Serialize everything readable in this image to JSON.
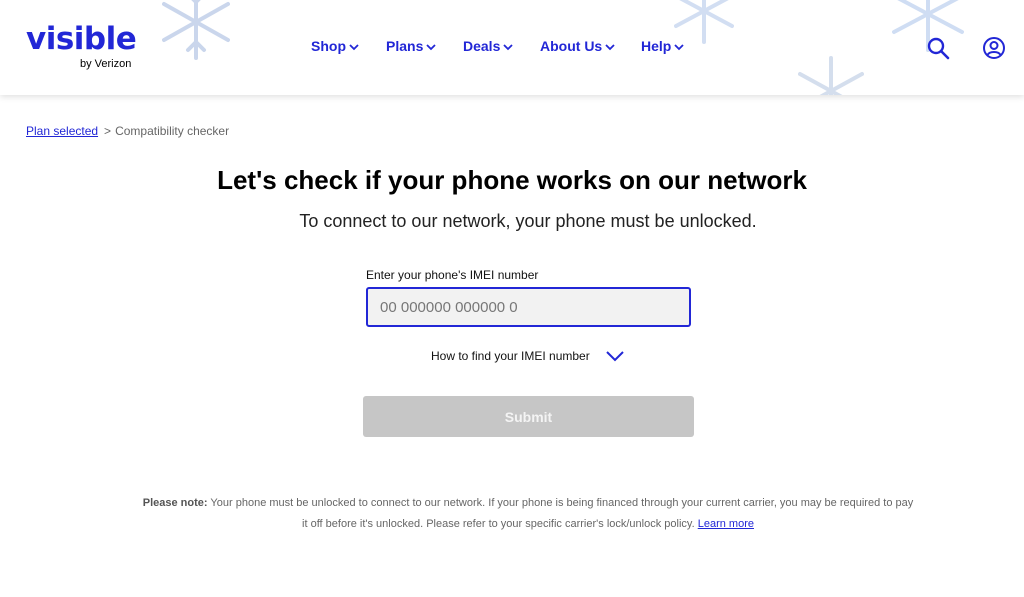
{
  "brand": {
    "name": "visible",
    "sub": "by Verizon",
    "accent": "#2227d6"
  },
  "nav": [
    {
      "label": "Shop"
    },
    {
      "label": "Plans"
    },
    {
      "label": "Deals"
    },
    {
      "label": "About Us"
    },
    {
      "label": "Help"
    }
  ],
  "header_icons": [
    "search-icon",
    "account-icon"
  ],
  "breadcrumb": {
    "link": "Plan selected",
    "separator": ">",
    "current": "Compatibility checker"
  },
  "main": {
    "title": "Let's check if your phone works on our network",
    "subtitle": "To connect to our network, your phone must be unlocked.",
    "imei_label": "Enter your phone's IMEI number",
    "imei_placeholder": "00 000000 000000 0",
    "imei_value": "",
    "howto_label": "How to find your IMEI number",
    "submit_label": "Submit"
  },
  "note": {
    "prefix": "Please note:",
    "text": " Your phone must be unlocked to connect to our network. If your phone is being financed through your current carrier, you may be required to pay it off before it's unlocked. Please refer to your specific carrier's lock/unlock policy. ",
    "link": "Learn more"
  }
}
